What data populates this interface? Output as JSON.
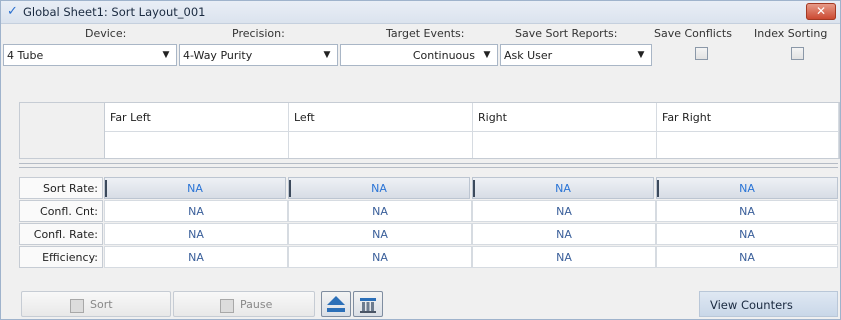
{
  "window": {
    "title": "Global Sheet1: Sort Layout_001",
    "close_label": "✕"
  },
  "settings": {
    "device_label": "Device:",
    "precision_label": "Precision:",
    "target_events_label": "Target Events:",
    "save_sort_reports_label": "Save Sort Reports:",
    "save_conflicts_label": "Save Conflicts",
    "index_sorting_label": "Index Sorting",
    "device_value": "4 Tube",
    "precision_value": "4-Way Purity",
    "target_events_value": "Continuous",
    "save_sort_reports_value": "Ask User",
    "save_conflicts_checked": false,
    "index_sorting_checked": false
  },
  "tubes": {
    "headers": [
      "Far Left",
      "Left",
      "Right",
      "Far Right"
    ],
    "values": [
      "",
      "",
      "",
      ""
    ]
  },
  "stats": {
    "rows": [
      {
        "label": "Sort Rate:",
        "values": [
          "NA",
          "NA",
          "NA",
          "NA"
        ]
      },
      {
        "label": "Confl. Cnt:",
        "values": [
          "NA",
          "NA",
          "NA",
          "NA"
        ]
      },
      {
        "label": "Confl. Rate:",
        "values": [
          "NA",
          "NA",
          "NA",
          "NA"
        ]
      },
      {
        "label": "Efficiency:",
        "values": [
          "NA",
          "NA",
          "NA",
          "NA"
        ]
      }
    ]
  },
  "toolbar": {
    "sort_label": "Sort",
    "pause_label": "Pause",
    "view_counters_label": "View Counters"
  },
  "icons": {
    "title": "checkmark-icon",
    "dropdown": "chevron-down-icon",
    "eject": "eject-icon",
    "sort_tray": "sort-tray-icon"
  },
  "colors": {
    "title_bar": "#dbe3ee",
    "close_button": "#c9442c",
    "na_rate_text": "#2a74d6",
    "na_text": "#3a5f9a",
    "view_counters": "#c9d7e8"
  }
}
